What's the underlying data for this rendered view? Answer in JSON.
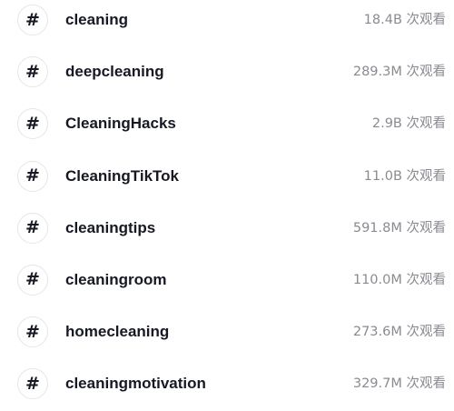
{
  "hashtags": [
    {
      "name": "cleaning",
      "views": "18.4B 次观看",
      "icon": "#"
    },
    {
      "name": "deepcleaning",
      "views": "289.3M 次观看",
      "icon": "#"
    },
    {
      "name": "CleaningHacks",
      "views": "2.9B 次观看",
      "icon": "#"
    },
    {
      "name": "CleaningTikTok",
      "views": "11.0B 次观看",
      "icon": "#"
    },
    {
      "name": "cleaningtips",
      "views": "591.8M 次观看",
      "icon": "#"
    },
    {
      "name": "cleaningroom",
      "views": "110.0M 次观看",
      "icon": "#"
    },
    {
      "name": "homecleaning",
      "views": "273.6M 次观看",
      "icon": "#"
    },
    {
      "name": "cleaningmotivation",
      "views": "329.7M 次观看",
      "icon": "#"
    }
  ],
  "colors": {
    "text_primary": "#161823",
    "text_secondary": "#8a8b91",
    "icon_border": "#e6e6e6",
    "background": "#ffffff"
  }
}
